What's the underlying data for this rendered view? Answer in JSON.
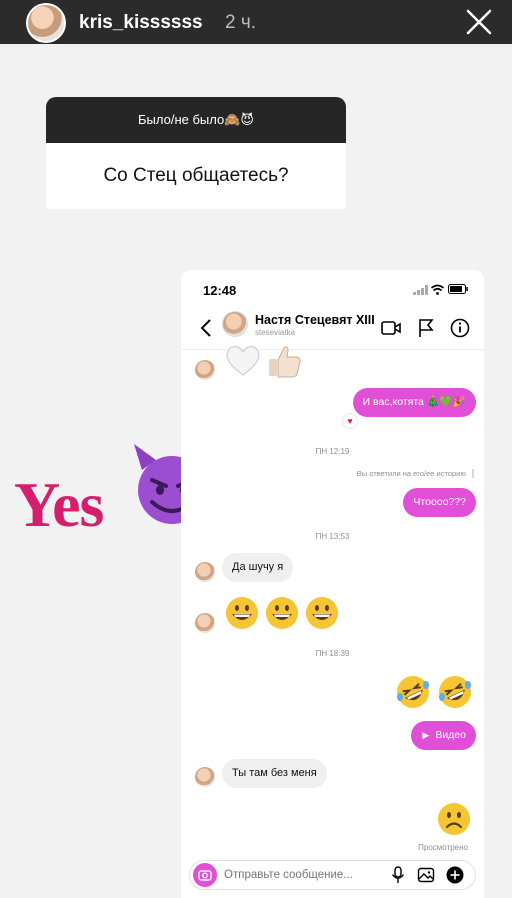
{
  "story": {
    "username": "kris_kissssss",
    "time": "2 ч."
  },
  "sticker": {
    "title": "Было/не было🙈😈",
    "question": "Со Стец общаетесь?"
  },
  "overlay": {
    "yes": "Yes"
  },
  "phone": {
    "status_time": "12:48",
    "contact_name": "Настя Стецевят XIII",
    "contact_handle": "steseviatka",
    "messages": {
      "out1": "И вас,котята 🎄💚🎉",
      "ts1": "ПН 12:19",
      "reply_note": "Вы ответили на его/ее историю",
      "out2": "Чтоооо???",
      "ts2": "ПН 13:53",
      "in1": "Да шучу я",
      "ts3": "ПН 18:39",
      "video_label": "Видео",
      "in2": "Ты там без меня",
      "seen": "Просмотрено"
    },
    "composer_placeholder": "Отправьте сообщение..."
  },
  "colors": {
    "accent": "#e14fd6",
    "yes": "#d4206c",
    "story_bar": "#2b2b2b"
  }
}
